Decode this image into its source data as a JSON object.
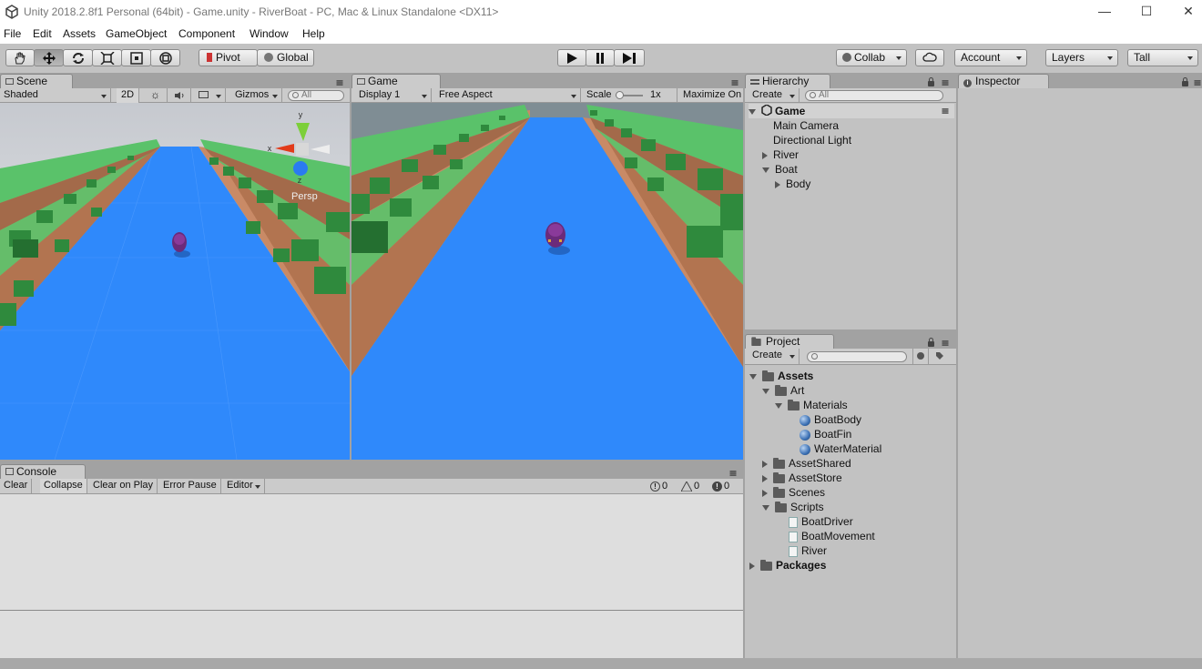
{
  "window": {
    "title": "Unity 2018.2.8f1 Personal (64bit) - Game.unity - RiverBoat - PC, Mac & Linux Standalone <DX11>",
    "minimize": "—",
    "maximize": "☐",
    "close": "✕"
  },
  "menu": [
    "File",
    "Edit",
    "Assets",
    "GameObject",
    "Component",
    "Window",
    "Help"
  ],
  "toolbar": {
    "pivot": "Pivot",
    "global": "Global",
    "collab": "Collab",
    "account": "Account",
    "layers": "Layers",
    "layout": "Tall"
  },
  "scene": {
    "tab": "Scene",
    "shading": "Shaded",
    "mode2d": "2D",
    "gizmos": "Gizmos",
    "search_placeholder": "All",
    "persp": "Persp",
    "axis_x": "x",
    "axis_y": "y",
    "axis_z": "z"
  },
  "game": {
    "tab": "Game",
    "display": "Display 1",
    "aspect": "Free Aspect",
    "scale_label": "Scale",
    "scale_value": "1x",
    "maximize": "Maximize On"
  },
  "hierarchy": {
    "tab": "Hierarchy",
    "create": "Create",
    "search_placeholder": "All",
    "scene_name": "Game",
    "items": [
      {
        "label": "Main Camera"
      },
      {
        "label": "Directional Light"
      },
      {
        "label": "River"
      },
      {
        "label": "Boat"
      },
      {
        "label": "Body"
      }
    ]
  },
  "project": {
    "tab": "Project",
    "create": "Create",
    "items": [
      {
        "label": "Assets"
      },
      {
        "label": "Art"
      },
      {
        "label": "Materials"
      },
      {
        "label": "BoatBody"
      },
      {
        "label": "BoatFin"
      },
      {
        "label": "WaterMaterial"
      },
      {
        "label": "AssetShared"
      },
      {
        "label": "AssetStore"
      },
      {
        "label": "Scenes"
      },
      {
        "label": "Scripts"
      },
      {
        "label": "BoatDriver"
      },
      {
        "label": "BoatMovement"
      },
      {
        "label": "River"
      },
      {
        "label": "Packages"
      }
    ]
  },
  "inspector": {
    "tab": "Inspector"
  },
  "console": {
    "tab": "Console",
    "clear": "Clear",
    "collapse": "Collapse",
    "clear_on_play": "Clear on Play",
    "error_pause": "Error Pause",
    "editor": "Editor",
    "info_count": "0",
    "warning_count": "0",
    "error_count": "0"
  },
  "colors": {
    "water": "#2f89fb",
    "grass": "#5ac26a",
    "dirt": "#c98a66",
    "bush": "#2f8a3d",
    "panel": "#c2c2c2"
  }
}
